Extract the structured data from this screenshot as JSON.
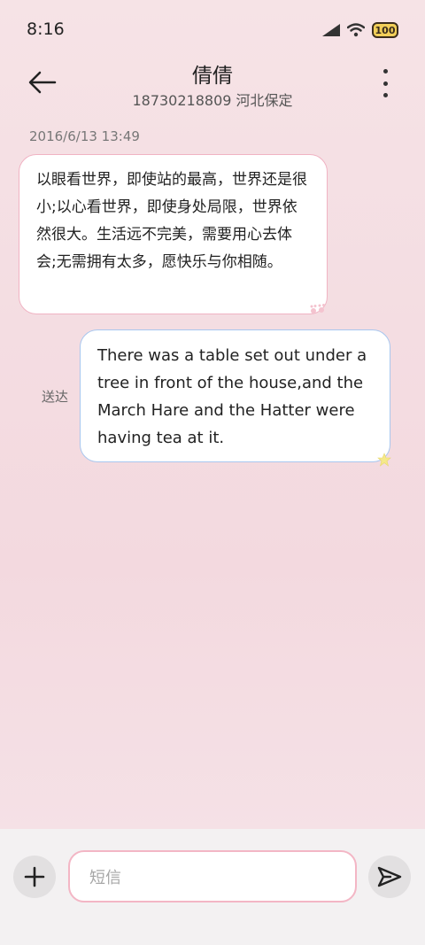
{
  "status_bar": {
    "time": "8:16",
    "battery": "100"
  },
  "header": {
    "title": "倩倩",
    "subtitle": "18730218809 河北保定"
  },
  "conversation": {
    "timestamp": "2016/6/13 13:49",
    "incoming_message": "以眼看世界，即使站的最高，世界还是很小;以心看世界，即使身处局限，世界依然很大。生活远不完美，需要用心去体会;无需拥有太多，愿快乐与你相随。",
    "outgoing_message": "There was a table set out under a tree in front of the house,and the March Hare and the Hatter were having tea at it.",
    "outgoing_status": "送达"
  },
  "composer": {
    "placeholder": "短信"
  },
  "icons": {
    "back": "arrow-left-icon",
    "menu": "more-vertical-icon",
    "add": "plus-icon",
    "send": "send-icon",
    "signal": "signal-icon",
    "wifi": "wifi-icon",
    "battery": "battery-icon"
  },
  "colors": {
    "incoming_border": "#f0b3c3",
    "outgoing_border": "#a8c7ef",
    "input_border": "#f3b6c5",
    "battery_fill": "#f2cf59"
  }
}
